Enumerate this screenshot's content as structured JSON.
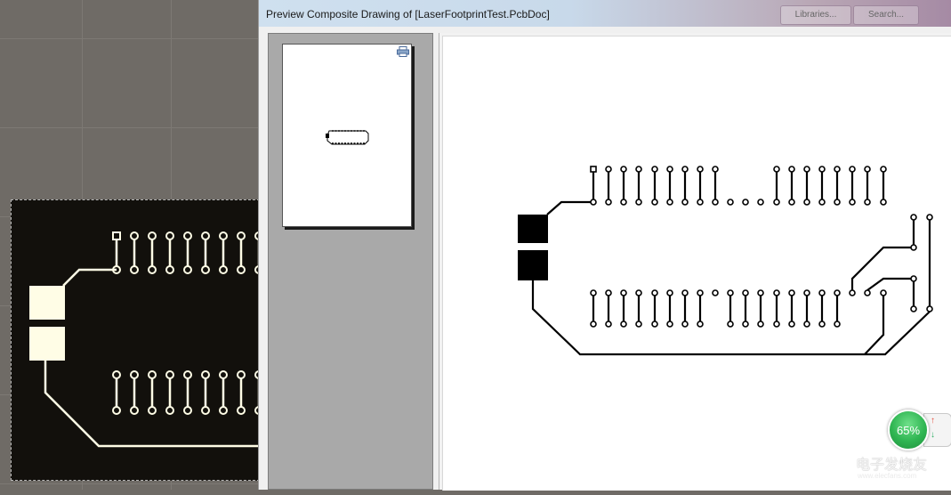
{
  "window": {
    "title": "Preview Composite Drawing of [LaserFootprintTest.PcbDoc]",
    "title_buttons": [
      "Libraries...",
      "Search..."
    ]
  },
  "zoom": {
    "level": "65%"
  },
  "watermark": {
    "text": "电子发烧友",
    "sub": "www.elecfans.com"
  },
  "icons": [
    "printer-icon",
    "up-arrow-icon",
    "down-arrow-icon",
    "watermark-logo-icon"
  ],
  "colors": {
    "pcb_background": "#12100c",
    "pcb_copper": "#fffde6",
    "preview_ink": "#000000",
    "zoom_green": "#2fb552"
  }
}
